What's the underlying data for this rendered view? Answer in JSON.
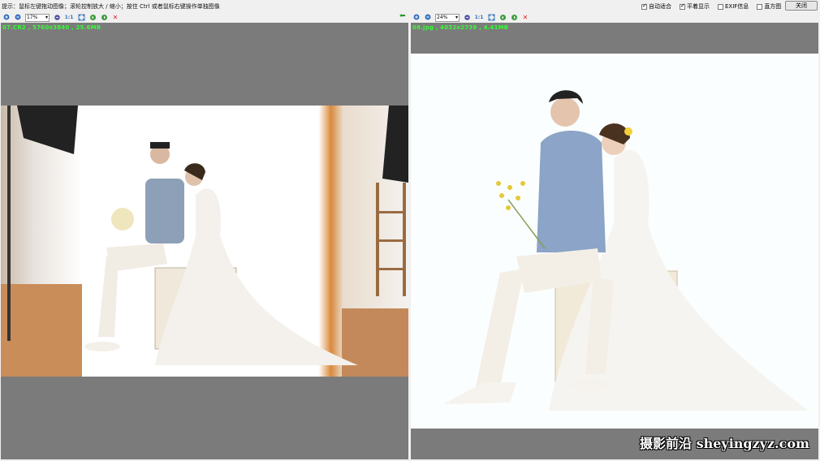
{
  "topbar": {
    "hint": "提示：鼠标左键拖动图像；滚轮控制放大 / 缩小；按住 Ctrl 或者鼠标右键操作单独图像",
    "options": [
      {
        "label": "自动适合",
        "checked": true
      },
      {
        "label": "平着显示",
        "checked": true
      },
      {
        "label": "EXIF信息",
        "checked": false
      },
      {
        "label": "直方图",
        "checked": false
      }
    ],
    "close_label": "关闭"
  },
  "left_viewer": {
    "zoom": "17%",
    "one_to_one": "1:1",
    "info": "07.CR2 , 5760x3840 , 25.6MB"
  },
  "right_viewer": {
    "zoom": "24%",
    "one_to_one": "1:1",
    "info": "08.jpg , 4032x2738 , 4.41MB"
  },
  "watermark": "摄影前沿 sheyingzyz.com",
  "colors": {
    "pane_bg": "#7b7b7b",
    "info_text": "#33ff33",
    "toolbar_bg": "#f0f0f0"
  }
}
